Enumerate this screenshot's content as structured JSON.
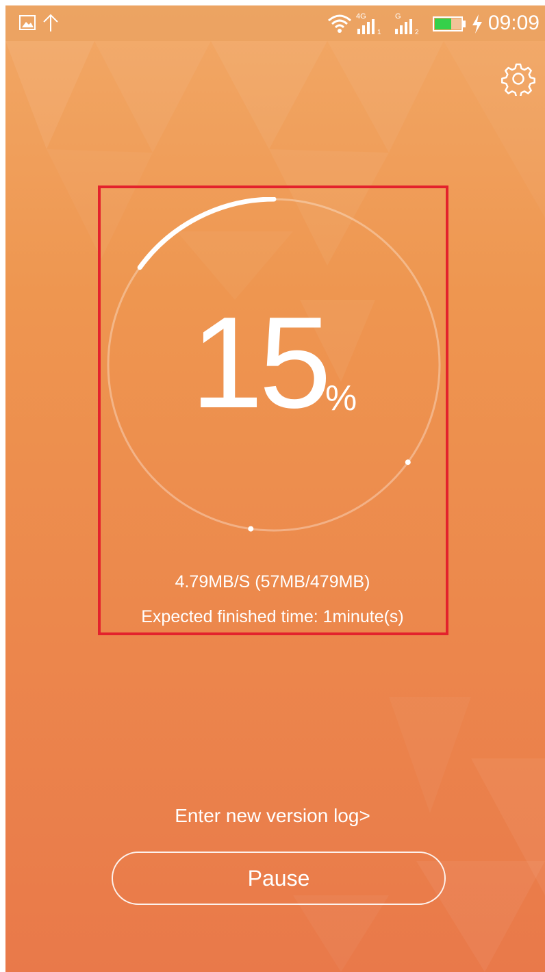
{
  "status_bar": {
    "time": "09:09",
    "icons": [
      "image-icon",
      "upload-arrow-icon",
      "wifi-icon",
      "signal-4g-sim1-icon",
      "signal-g-sim2-icon",
      "battery-icon",
      "charging-bolt-icon"
    ],
    "sim1_network": "4G",
    "sim2_network": "G",
    "battery_color": "#35d04a"
  },
  "header": {
    "settings_icon": "gear-icon"
  },
  "progress": {
    "percent_value": "15",
    "percent_sign": "%",
    "fraction": 0.15,
    "speed_text": "4.79MB/S (57MB/479MB)",
    "eta_text": "Expected finished time: 1minute(s)"
  },
  "actions": {
    "log_link": "Enter new version log>",
    "pause_label": "Pause"
  },
  "colors": {
    "background_top": "#f2a866",
    "background_bottom": "#e9794a",
    "highlight_box": "#e3222c",
    "foreground": "#ffffff"
  }
}
